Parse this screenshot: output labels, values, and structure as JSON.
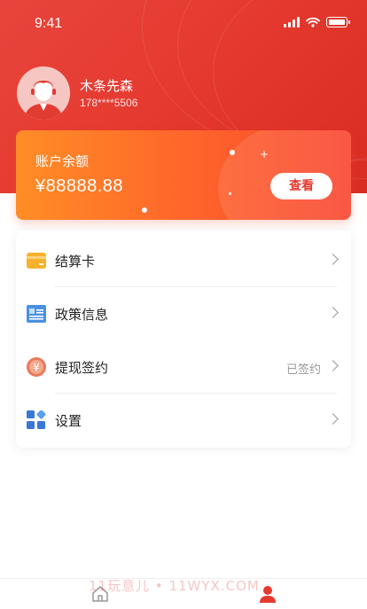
{
  "status_bar": {
    "time": "9:41"
  },
  "profile": {
    "name": "木条先森",
    "phone": "178****5506"
  },
  "balance": {
    "label": "账户余额",
    "amount": "¥88888.88",
    "view_button": "查看"
  },
  "menu": [
    {
      "label": "结算卡",
      "icon": "card-icon",
      "value": ""
    },
    {
      "label": "政策信息",
      "icon": "document-icon",
      "value": ""
    },
    {
      "label": "提现签约",
      "icon": "yuan-coin-icon",
      "value": "已签约"
    },
    {
      "label": "设置",
      "icon": "settings-grid-icon",
      "value": ""
    }
  ],
  "watermark": "11玩意儿 • 11WYX.COM",
  "tabbar": [
    {
      "icon": "home-icon",
      "active": false
    },
    {
      "icon": "user-icon",
      "active": true
    }
  ],
  "colors": {
    "brand_red": "#e53a30",
    "orange": "#ff8d26",
    "tab_active": "#e53a30",
    "tab_inactive": "#999999"
  }
}
